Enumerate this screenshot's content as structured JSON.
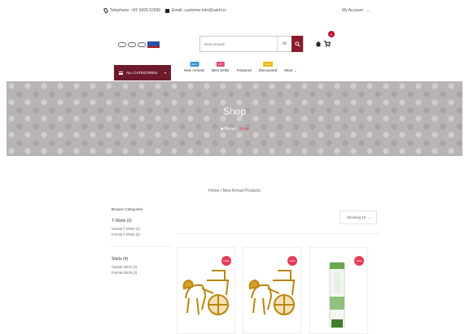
{
  "topbar": {
    "phone": "Telephone: +91 9425 62990",
    "email": "Email: customer.info@sakhi.in",
    "account": "My Account"
  },
  "search": {
    "placeholder": "New Arrivals",
    "category": "All"
  },
  "cart": {
    "count": "0"
  },
  "nav": {
    "all_categories": "ALL CATEGORIES",
    "items": [
      {
        "label": "New Arrivals",
        "badge": "NEW",
        "badge_color": "#2f8fd4"
      },
      {
        "label": "Best Seller",
        "badge": "HOT",
        "badge_color": "#e0476b"
      },
      {
        "label": "Featured",
        "badge": "",
        "badge_color": ""
      },
      {
        "label": "Discounted",
        "badge": "SALE",
        "badge_color": "#f2b705"
      },
      {
        "label": "More",
        "badge": "",
        "badge_color": ""
      }
    ]
  },
  "banner": {
    "title": "Shop",
    "crumb_home": "Home",
    "crumb_sep": "/",
    "crumb_current": "Shop"
  },
  "page": {
    "breadcrumb": "Home / New Arrival Products",
    "sort_label": "Showing 15"
  },
  "sidebar": {
    "heading": "Browse Categories",
    "groups": [
      {
        "title": "T-Shirts (3)",
        "items": [
          "Casual T-Shirts (1)",
          "Formal T-Shirts (2)"
        ]
      },
      {
        "title": "Shirts (4)",
        "items": [
          "Casual Shirts (2)",
          "Formal Shirts (2)"
        ]
      }
    ]
  },
  "products": [
    {
      "badge": "NEW",
      "image_icon": "brass-horse-cart-icon"
    },
    {
      "badge": "NEW",
      "image_icon": "brass-horse-cart-icon"
    },
    {
      "badge": "NEW",
      "image_icon": "cream-tube-icon"
    }
  ],
  "colors": {
    "brand": "#6e1a2a",
    "banner_bg": "#b9b4b4",
    "badge": "#e53a55",
    "crumb_active": "#e23a4d"
  }
}
